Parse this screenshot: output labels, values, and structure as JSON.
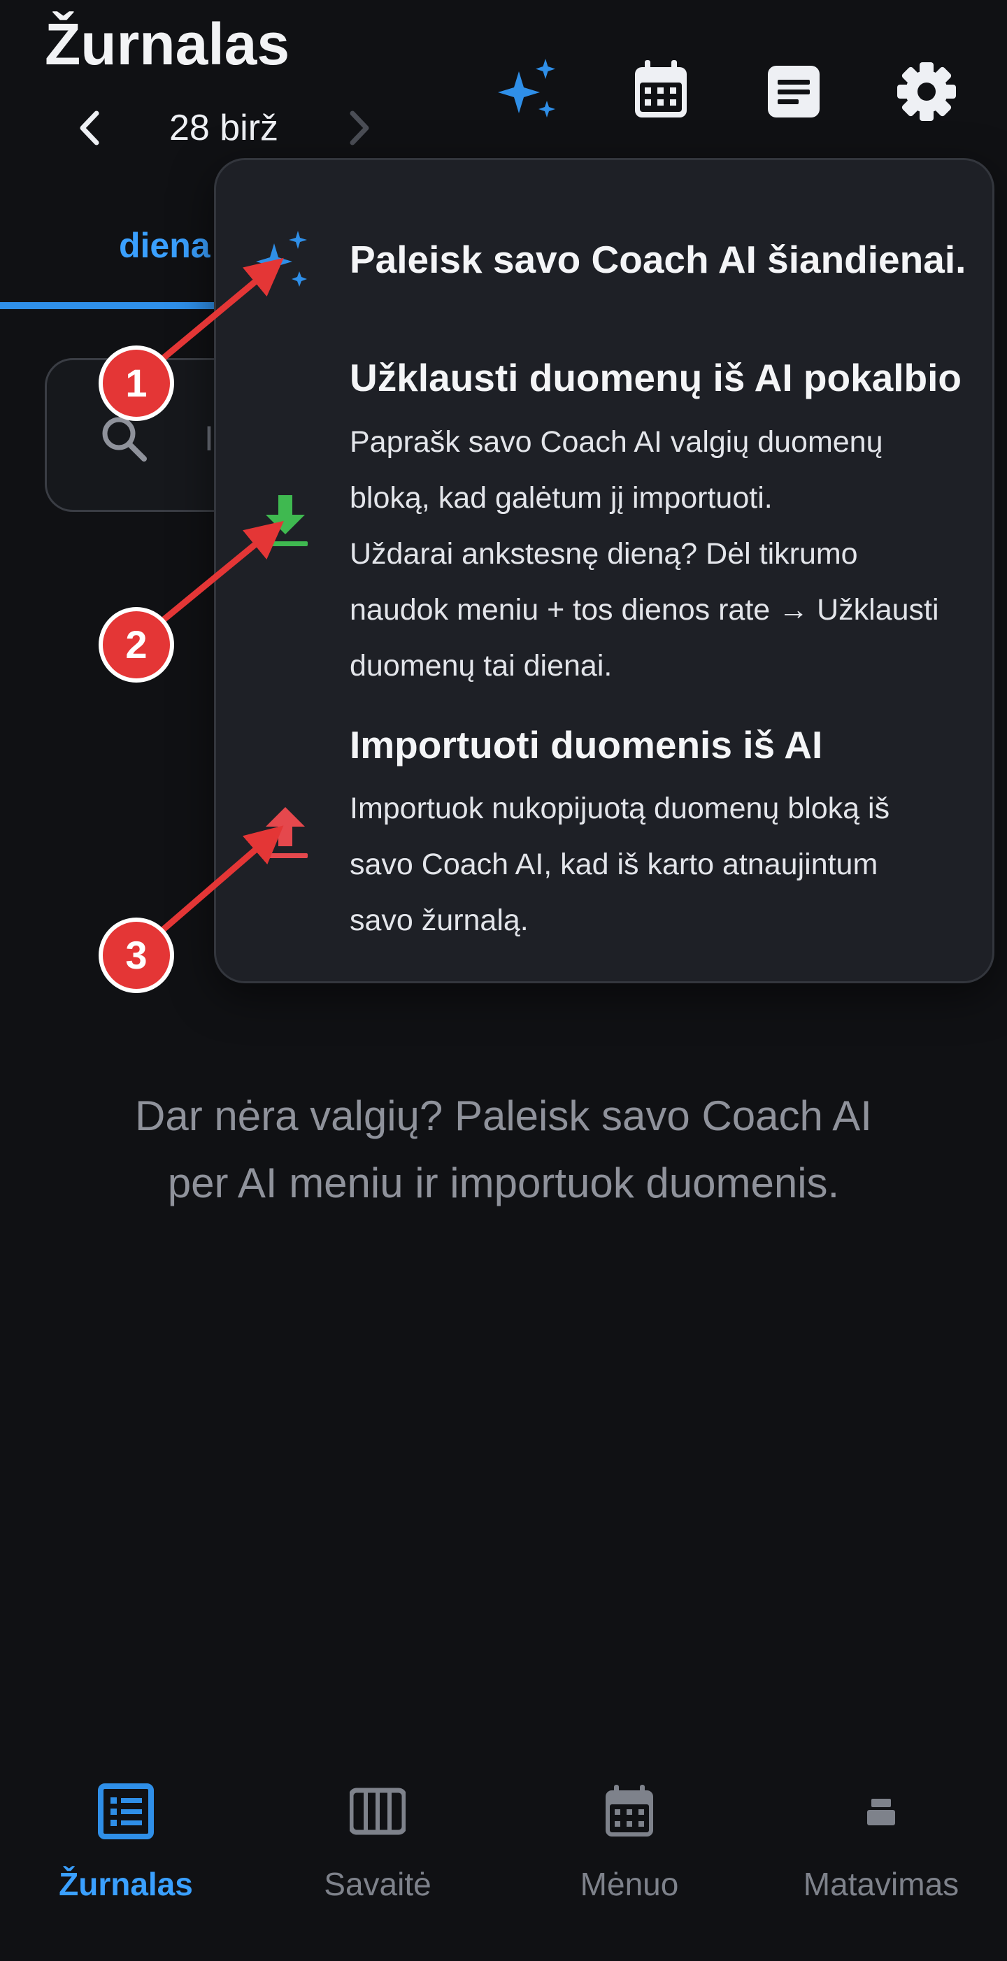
{
  "header": {
    "title": "Žurnalas",
    "date": "28 birž",
    "actions": [
      {
        "icon": "sparkles-icon",
        "color": "#2f8fe8"
      },
      {
        "icon": "calendar-icon",
        "color": "#eef0f4"
      },
      {
        "icon": "notes-icon",
        "color": "#eef0f4"
      },
      {
        "icon": "gear-icon",
        "color": "#eef0f4"
      }
    ]
  },
  "tabs": {
    "active_label": "diena"
  },
  "search": {
    "placeholder_fragment": "I"
  },
  "popover": {
    "item1": {
      "icon": "sparkles-icon",
      "title": "Paleisk savo Coach AI šiandienai."
    },
    "item2": {
      "icon": "download-icon",
      "title": "Užklausti duomenų iš AI pokalbio",
      "body_lines": [
        "Paprašk savo Coach AI valgių duomenų",
        "bloką, kad galėtum jį importuoti.",
        "Uždarai ankstesnę dieną? Dėl tikrumo",
        "naudok meniu + tos dienos rate → Užklausti",
        "duomenų tai dienai."
      ]
    },
    "item3": {
      "icon": "upload-icon",
      "title": "Importuoti duomenis iš AI",
      "body_lines": [
        "Importuok nukopijuotą duomenų bloką iš",
        "savo Coach AI, kad iš karto atnaujintum",
        "savo žurnalą."
      ]
    }
  },
  "annotations": [
    "1",
    "2",
    "3"
  ],
  "empty_state": {
    "line1": "Dar nėra valgių? Paleisk savo Coach AI",
    "line2": "per AI meniu ir importuok duomenis."
  },
  "bottom_nav": {
    "items": [
      {
        "label": "Žurnalas",
        "icon": "list-icon",
        "active": true
      },
      {
        "label": "Savaitė",
        "icon": "week-columns-icon",
        "active": false
      },
      {
        "label": "Mėnuo",
        "icon": "calendar-icon",
        "active": false
      },
      {
        "label": "Matavimas",
        "icon": "scale-icon",
        "active": false
      }
    ]
  },
  "colors": {
    "background": "#101114",
    "accent": "#2f8fe8",
    "popover_bg": "#1e2026",
    "download_icon": "#3fb950",
    "upload_icon": "#e5484d",
    "annotation": "#e43636"
  }
}
